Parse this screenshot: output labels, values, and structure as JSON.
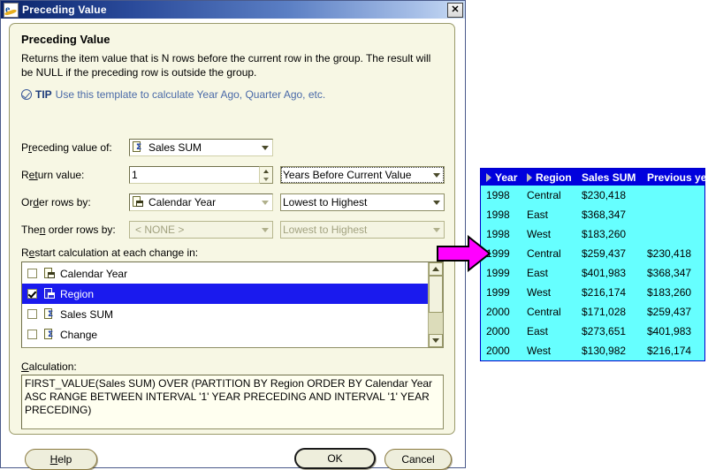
{
  "window": {
    "title": "Preceding Value",
    "icon": "ie-document-icon",
    "close_label": "✕"
  },
  "panel": {
    "heading": "Preceding Value",
    "description": "Returns the item value that is N rows before the current row in the group.  The result will be NULL if the preceding row is outside the group.",
    "tip_word": "TIP",
    "tip_text": "Use this template to calculate Year Ago, Quarter Ago, etc."
  },
  "fields": {
    "preceding_value_of": {
      "label_pre": "P",
      "label_key": "r",
      "label_post": "eceding value of:",
      "value": "Sales SUM",
      "icon": "measure-icon"
    },
    "return_value": {
      "label_pre": "R",
      "label_key": "et",
      "label_post": "urn value:",
      "value": "1",
      "unit_value": "Years Before Current Value"
    },
    "order_rows_by": {
      "label_pre": "Or",
      "label_key": "d",
      "label_post": "er rows by:",
      "value": "Calendar Year",
      "icon": "dimension-icon",
      "direction": "Lowest to Highest"
    },
    "then_order_rows_by": {
      "label_pre": "The",
      "label_key": "n",
      "label_post": " order rows by:",
      "value": "< NONE >",
      "direction": "Lowest to Highest",
      "disabled": true
    }
  },
  "restart": {
    "label_pre": "R",
    "label_key": "e",
    "label_post": "start calculation at each change in:",
    "items": [
      {
        "label": "Calendar Year",
        "checked": false,
        "selected": false,
        "icon": "dimension-icon"
      },
      {
        "label": "Region",
        "checked": true,
        "selected": true,
        "icon": "dimension-icon"
      },
      {
        "label": "Sales SUM",
        "checked": false,
        "selected": false,
        "icon": "measure-icon"
      },
      {
        "label": "Change",
        "checked": false,
        "selected": false,
        "icon": "measure-icon"
      }
    ]
  },
  "calculation": {
    "label_pre": "",
    "label_key": "C",
    "label_post": "alculation:",
    "expression": "FIRST_VALUE(Sales SUM) OVER (PARTITION BY Region ORDER BY Calendar Year ASC RANGE BETWEEN INTERVAL '1' YEAR PRECEDING AND INTERVAL '1' YEAR PRECEDING)"
  },
  "buttons": {
    "help": "Help",
    "help_key": "H",
    "ok": "OK",
    "cancel": "Cancel"
  },
  "result_table": {
    "columns": [
      "Year",
      "Region",
      "Sales SUM",
      "Previous year"
    ],
    "rows": [
      [
        "1998",
        "Central",
        "$230,418",
        ""
      ],
      [
        "1998",
        "East",
        "$368,347",
        ""
      ],
      [
        "1998",
        "West",
        "$183,260",
        ""
      ],
      [
        "1999",
        "Central",
        "$259,437",
        "$230,418"
      ],
      [
        "1999",
        "East",
        "$401,983",
        "$368,347"
      ],
      [
        "1999",
        "West",
        "$216,174",
        "$183,260"
      ],
      [
        "2000",
        "Central",
        "$171,028",
        "$259,437"
      ],
      [
        "2000",
        "East",
        "$273,651",
        "$401,983"
      ],
      [
        "2000",
        "West",
        "$130,982",
        "$216,174"
      ]
    ]
  },
  "colors": {
    "titlebar_start": "#0a246a",
    "titlebar_end": "#c9dcf5",
    "panel_bg": "#f7f7e4",
    "selection": "#1a1aee",
    "table_header": "#0000dd",
    "table_body": "#66ffff",
    "arrow": "#ff00ff",
    "tip": "#4a6aa8"
  }
}
